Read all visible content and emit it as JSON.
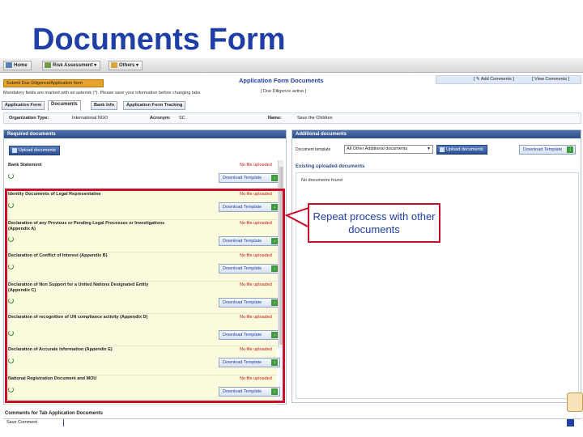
{
  "slide": {
    "title": "Documents Form"
  },
  "nav": {
    "home": "Home",
    "risk": "Risk Assessment ▾",
    "others": "Others ▾"
  },
  "header": {
    "submit_button": "Submit Due Diligence/Application form",
    "note": "Mandatory fields are marked with an asterisk (*). Please save your information before changing tabs",
    "title": "Application Form Documents",
    "status": "[ Due Diligence active ]",
    "add_comments": "[ ✎ Add Comments ]",
    "view_comments": "[ View Comments ]"
  },
  "tabs": [
    {
      "label": "Application Form"
    },
    {
      "label": "Documents"
    },
    {
      "label": "Bank Info"
    },
    {
      "label": "Application Form Tracking"
    }
  ],
  "org": {
    "type_label": "Organization Type:",
    "type_value": "International NGO",
    "acronym_label": "Acronym:",
    "acronym_value": "SC",
    "name_label": "Name:",
    "name_value": "Save the Children"
  },
  "required": {
    "heading": "Required documents",
    "upload_label": "Upload documents",
    "download_label": "Download Template",
    "status_text": "No file uploaded",
    "documents": [
      {
        "name": "Bank Statement"
      },
      {
        "name": "Identity Documents of Legal Representative"
      },
      {
        "name": "Declaration of any Previous or Pending Legal Processes or Investigations (Appendix A)"
      },
      {
        "name": "Declaration of Conflict of Interest (Appendix B)"
      },
      {
        "name": "Declaration of Non Support for a United Nations Designated Entity (Appendix C)"
      },
      {
        "name": "Declaration of recognition of UN compliance activity (Appendix D)"
      },
      {
        "name": "Declaration of Accurate Information (Appendix E)"
      },
      {
        "name": "National Registration Document and MOU"
      }
    ]
  },
  "additional": {
    "heading": "Additional documents",
    "select_label": "Document template",
    "select_value": "All Other Additional documents",
    "upload_label": "Upload documents",
    "download_label": "Download Template",
    "existing_heading": "Existing uploaded documents",
    "no_docs": "No documents found"
  },
  "callout": {
    "text": "Repeat process with other documents"
  },
  "comments": {
    "heading": "Comments for Tab Application Documents",
    "save_label": "Save Comment"
  },
  "colors": {
    "title_blue": "#1f3fa6",
    "highlight_red": "#c8102e",
    "status_red": "#cc1111",
    "panel_blue": "#2e4f86",
    "row_yellow": "#fdfbdd"
  }
}
